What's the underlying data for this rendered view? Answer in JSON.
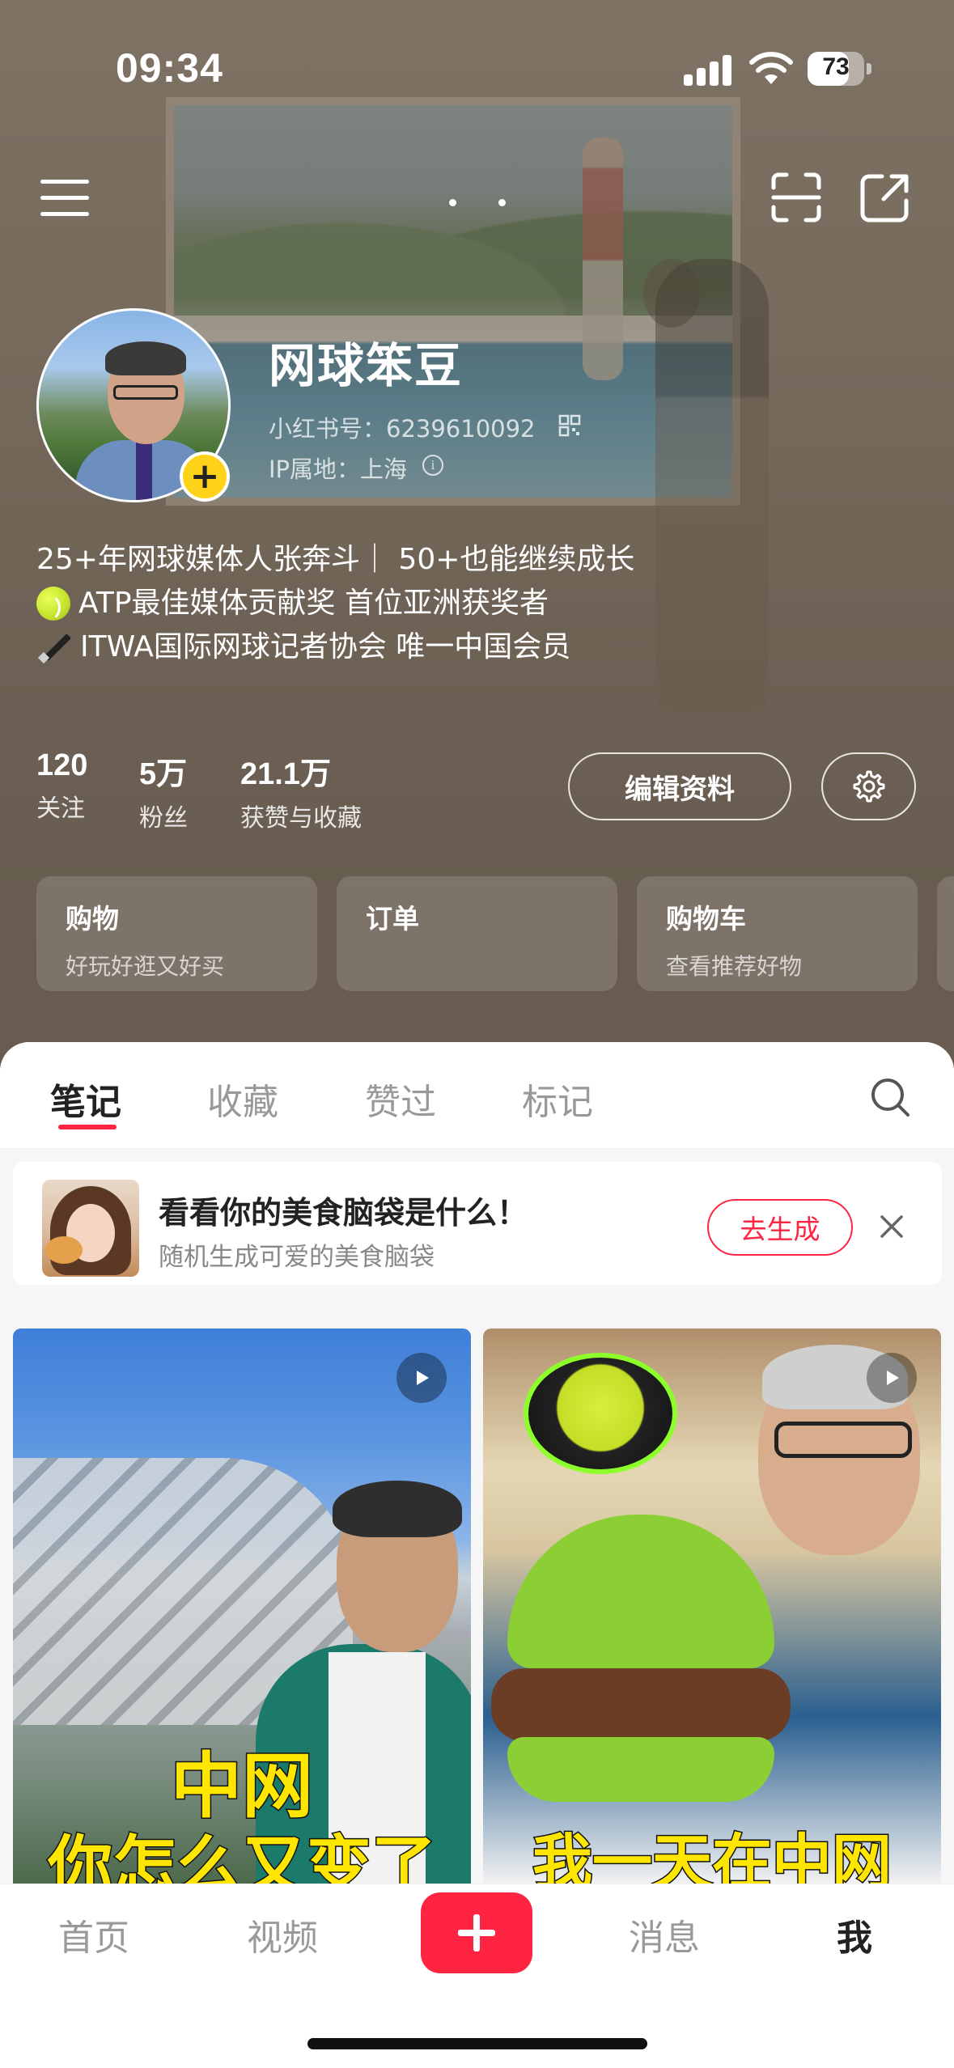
{
  "status_bar": {
    "time": "09:34",
    "battery": "73",
    "battery_level_percent": 73
  },
  "profile": {
    "username": "网球笨豆",
    "xhs_id": "小红书号：6239610092",
    "ip_location": "IP属地：上海",
    "bio": [
      "25+年网球媒体人张奔斗｜ 50+也能继续成长",
      "ATP最佳媒体贡献奖 首位亚洲获奖者",
      "ITWA国际网球记者协会 唯一中国会员"
    ],
    "stats": [
      {
        "value": "120",
        "label": "关注"
      },
      {
        "value": "5万",
        "label": "粉丝"
      },
      {
        "value": "21.1万",
        "label": "获赞与收藏"
      }
    ],
    "edit_button": "编辑资料"
  },
  "shortcuts": [
    {
      "title": "购物",
      "subtitle": "好玩好逛又好买"
    },
    {
      "title": "订单",
      "subtitle": ""
    },
    {
      "title": "购物车",
      "subtitle": "查看推荐好物"
    }
  ],
  "tabs": [
    {
      "label": "笔记",
      "active": true
    },
    {
      "label": "收藏",
      "active": false
    },
    {
      "label": "赞过",
      "active": false
    },
    {
      "label": "标记",
      "active": false
    }
  ],
  "promo": {
    "title": "看看你的美食脑袋是什么！",
    "subtitle": "随机生成可爱的美食脑袋",
    "button": "去生成"
  },
  "notes": [
    {
      "caption_lines": [
        "中网",
        "你怎么又变了"
      ],
      "type": "video"
    },
    {
      "caption_lines": [
        "我一天在中网"
      ],
      "type": "video"
    }
  ],
  "bottom_nav": [
    {
      "label": "首页",
      "active": false
    },
    {
      "label": "视频",
      "active": false
    },
    {
      "label": "消息",
      "active": false
    },
    {
      "label": "我",
      "active": true
    }
  ],
  "colors": {
    "accent": "#ff2442",
    "badge_yellow": "#ffd21a"
  },
  "icons": [
    "menu-icon",
    "scan-icon",
    "share-icon",
    "qr-code-icon",
    "info-icon",
    "tennis-ball-icon",
    "pen-icon",
    "settings-gear-icon",
    "search-icon",
    "close-icon",
    "play-icon",
    "plus-icon"
  ]
}
